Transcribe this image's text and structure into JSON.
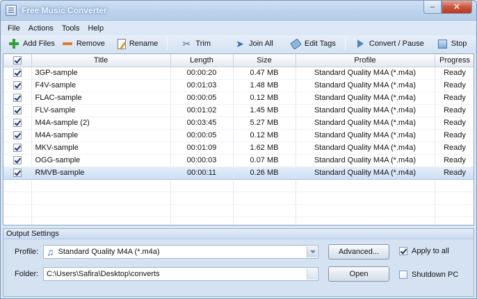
{
  "window": {
    "title": "Free Music Converter"
  },
  "menu": [
    "File",
    "Actions",
    "Tools",
    "Help"
  ],
  "toolbar": {
    "add_files": "Add Files",
    "remove": "Remove",
    "rename": "Rename",
    "trim": "Trim",
    "join_all": "Join All",
    "edit_tags": "Edit Tags",
    "convert_pause": "Convert / Pause",
    "stop": "Stop"
  },
  "table": {
    "columns": {
      "title": "Title",
      "length": "Length",
      "size": "Size",
      "profile": "Profile",
      "progress": "Progress"
    },
    "rows": [
      {
        "checked": true,
        "title": "3GP-sample",
        "length": "00:00:20",
        "size": "0.47 MB",
        "profile": "Standard Quality M4A (*.m4a)",
        "progress": "Ready"
      },
      {
        "checked": true,
        "title": "F4V-sample",
        "length": "00:01:03",
        "size": "1.48 MB",
        "profile": "Standard Quality M4A (*.m4a)",
        "progress": "Ready"
      },
      {
        "checked": true,
        "title": "FLAC-sample",
        "length": "00:00:05",
        "size": "0.12 MB",
        "profile": "Standard Quality M4A (*.m4a)",
        "progress": "Ready"
      },
      {
        "checked": true,
        "title": "FLV-sample",
        "length": "00:01:02",
        "size": "1.45 MB",
        "profile": "Standard Quality M4A (*.m4a)",
        "progress": "Ready"
      },
      {
        "checked": true,
        "title": "M4A-sample (2)",
        "length": "00:03:45",
        "size": "5.27 MB",
        "profile": "Standard Quality M4A (*.m4a)",
        "progress": "Ready"
      },
      {
        "checked": true,
        "title": "M4A-sample",
        "length": "00:00:05",
        "size": "0.12 MB",
        "profile": "Standard Quality M4A (*.m4a)",
        "progress": "Ready"
      },
      {
        "checked": true,
        "title": "MKV-sample",
        "length": "00:01:09",
        "size": "1.62 MB",
        "profile": "Standard Quality M4A (*.m4a)",
        "progress": "Ready"
      },
      {
        "checked": true,
        "title": "OGG-sample",
        "length": "00:00:03",
        "size": "0.07 MB",
        "profile": "Standard Quality M4A (*.m4a)",
        "progress": "Ready"
      },
      {
        "checked": true,
        "title": "RMVB-sample",
        "length": "00:00:11",
        "size": "0.26 MB",
        "profile": "Standard Quality M4A (*.m4a)",
        "progress": "Ready",
        "selected": true
      }
    ],
    "empty_rows": 4
  },
  "output": {
    "heading": "Output Settings",
    "profile_label": "Profile:",
    "profile_value": "Standard Quality M4A (*.m4a)",
    "folder_label": "Folder:",
    "folder_value": "C:\\Users\\Safira\\Desktop\\converts",
    "advanced_button": "Advanced...",
    "open_button": "Open",
    "apply_to_all": {
      "label": "Apply to all",
      "checked": true
    },
    "shutdown_pc": {
      "label": "Shutdown PC",
      "checked": false
    }
  }
}
